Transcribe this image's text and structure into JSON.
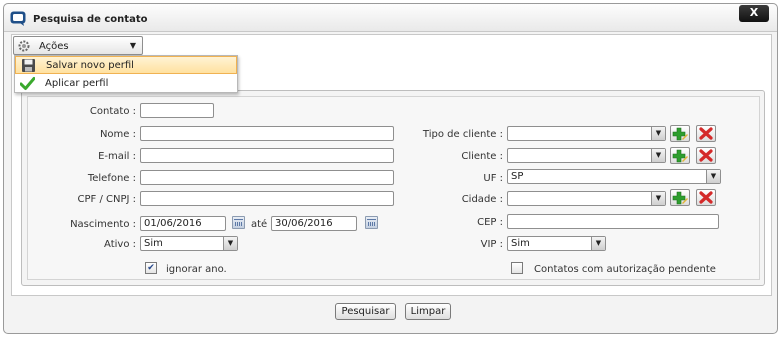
{
  "window": {
    "title": "Pesquisa de contato",
    "close_label": "X"
  },
  "acoes": {
    "label": "Ações"
  },
  "menu": {
    "items": [
      {
        "label": "Salvar novo perfil",
        "icon": "save-icon"
      },
      {
        "label": "Aplicar perfil",
        "icon": "checkmark-icon"
      }
    ]
  },
  "form": {
    "contato": {
      "label": "Contato :",
      "value": ""
    },
    "nome": {
      "label": "Nome :",
      "value": ""
    },
    "email": {
      "label": "E-mail :",
      "value": ""
    },
    "telefone": {
      "label": "Telefone :",
      "value": ""
    },
    "cpf": {
      "label": "CPF / CNPJ :",
      "value": ""
    },
    "nascimento": {
      "label": "Nascimento :",
      "from": "01/06/2016",
      "ate_label": "até",
      "to": "30/06/2016"
    },
    "ativo": {
      "label": "Ativo :",
      "value": "Sim"
    },
    "ignorar_ano": {
      "label": "ignorar ano.",
      "checked": true
    },
    "tipo_cliente": {
      "label": "Tipo de cliente :",
      "value": ""
    },
    "cliente": {
      "label": "Cliente :",
      "value": ""
    },
    "uf": {
      "label": "UF :",
      "value": "SP"
    },
    "cidade": {
      "label": "Cidade :",
      "value": ""
    },
    "cep": {
      "label": "CEP :",
      "value": ""
    },
    "vip": {
      "label": "VIP :",
      "value": "Sim"
    },
    "autorizacao": {
      "label": "Contatos com autorização pendente",
      "checked": false
    }
  },
  "buttons": {
    "pesquisar": "Pesquisar",
    "limpar": "Limpar"
  },
  "colors": {
    "highlight": "#ffe1a0",
    "highlight_border": "#f0b252",
    "add_green": "#2e9e2e",
    "delete_red": "#d42a2a"
  }
}
